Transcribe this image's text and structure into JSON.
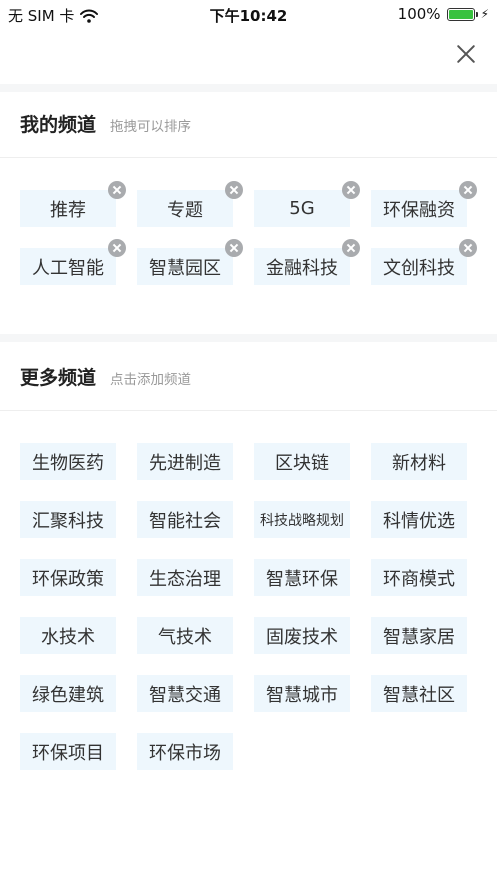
{
  "status_bar": {
    "carrier": "无 SIM 卡",
    "time": "下午10:42",
    "battery_percent": "100%",
    "battery_level": 1.0,
    "icons": [
      "wifi-icon",
      "battery-icon",
      "charging-bolt-icon"
    ]
  },
  "close_icon": "close-icon",
  "my_channels": {
    "title": "我的频道",
    "hint": "拖拽可以排序",
    "items": [
      "推荐",
      "专题",
      "5G",
      "环保融资",
      "人工智能",
      "智慧园区",
      "金融科技",
      "文创科技"
    ]
  },
  "more_channels": {
    "title": "更多频道",
    "hint": "点击添加频道",
    "items": [
      "生物医药",
      "先进制造",
      "区块链",
      "新材料",
      "汇聚科技",
      "智能社会",
      "科技战略规划",
      "科情优选",
      "环保政策",
      "生态治理",
      "智慧环保",
      "环商模式",
      "水技术",
      "气技术",
      "固废技术",
      "智慧家居",
      "绿色建筑",
      "智慧交通",
      "智慧城市",
      "智慧社区",
      "环保项目",
      "环保市场"
    ]
  },
  "colors": {
    "chip_bg": "#eef7fd",
    "badge": "#a9abae",
    "battery": "#38c23f"
  }
}
